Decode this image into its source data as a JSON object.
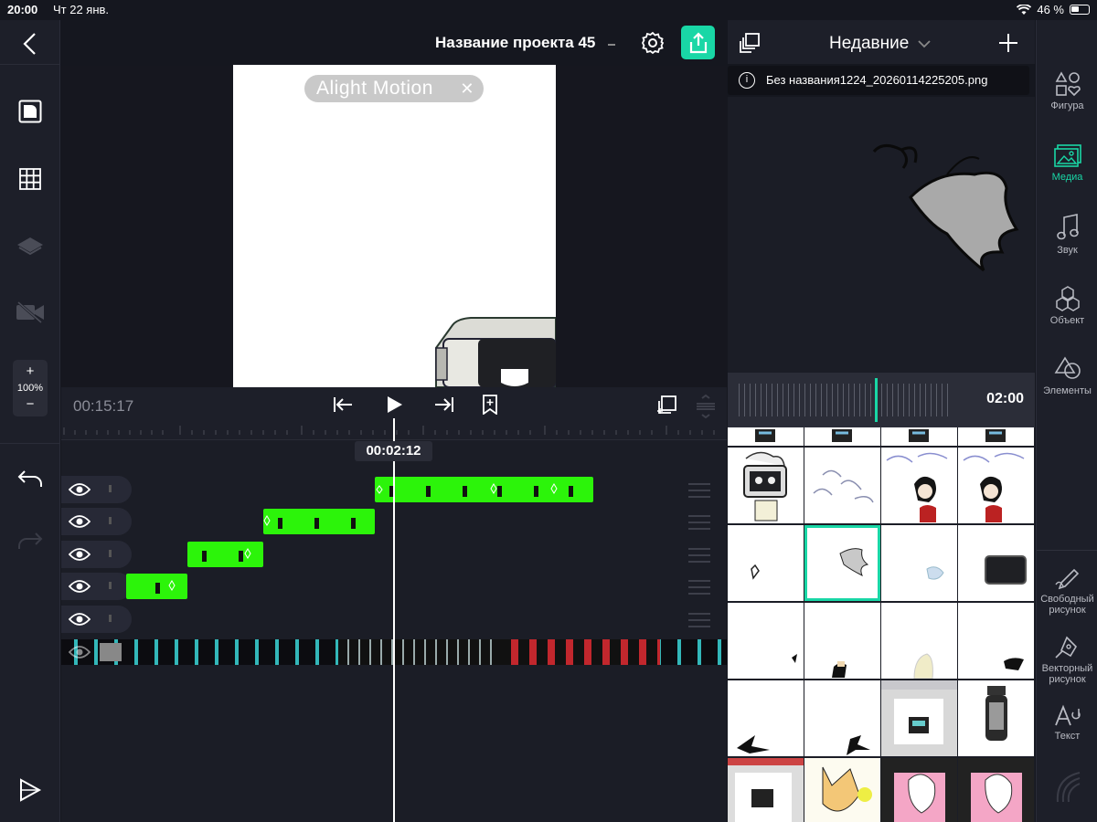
{
  "status_bar": {
    "time": "20:00",
    "date": "Чт 22 янв.",
    "battery": "46 %"
  },
  "header": {
    "project_title": "Название проекта 45"
  },
  "canvas": {
    "watermark": "Alight Motion"
  },
  "left_toolbar": {
    "zoom_plus": "+",
    "zoom_level": "100%",
    "zoom_minus": "−"
  },
  "timeline": {
    "total_time": "00:15:17",
    "playhead_time": "00:02:12",
    "tracks": 5
  },
  "media_panel": {
    "dropdown_label": "Недавние",
    "selected_file": "Без названия1224_20260114225205.png",
    "duration": "02:00"
  },
  "right_toolbar": {
    "items": [
      {
        "label": "Фигура"
      },
      {
        "label": "Медиа"
      },
      {
        "label": "Звук"
      },
      {
        "label": "Объект"
      },
      {
        "label": "Элементы"
      },
      {
        "label": "Свободный рисунок"
      },
      {
        "label": "Векторный рисунок"
      },
      {
        "label": "Текст"
      }
    ]
  },
  "colors": {
    "accent": "#19d7a6",
    "clip": "#2cf40a",
    "background": "#15171f"
  }
}
